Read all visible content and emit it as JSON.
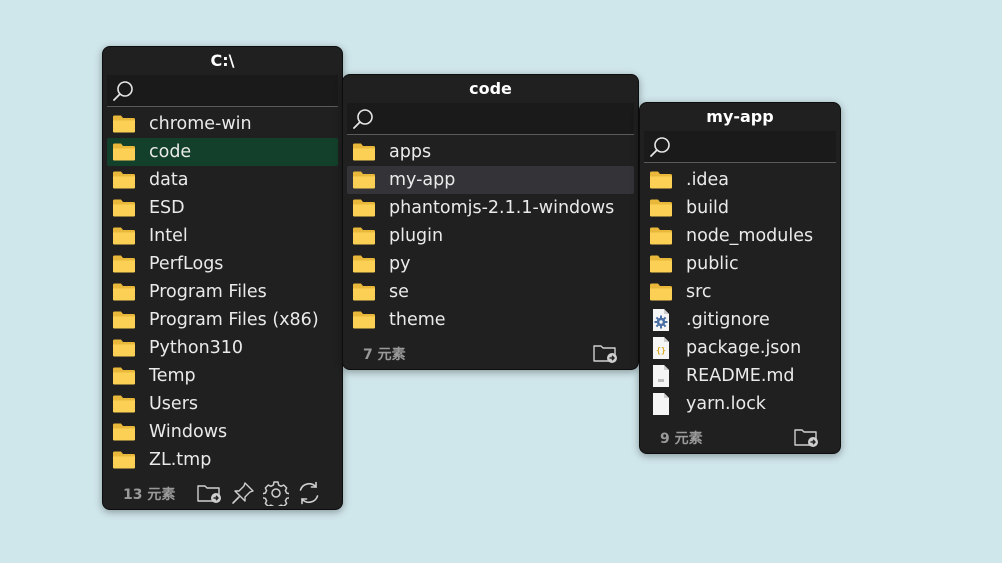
{
  "panels": [
    {
      "title": "C:\\",
      "search_placeholder": "",
      "items": [
        {
          "label": "chrome-win",
          "type": "folder"
        },
        {
          "label": "code",
          "type": "folder"
        },
        {
          "label": "data",
          "type": "folder"
        },
        {
          "label": "ESD",
          "type": "folder"
        },
        {
          "label": "Intel",
          "type": "folder"
        },
        {
          "label": "PerfLogs",
          "type": "folder"
        },
        {
          "label": "Program Files",
          "type": "folder"
        },
        {
          "label": "Program Files (x86)",
          "type": "folder"
        },
        {
          "label": "Python310",
          "type": "folder"
        },
        {
          "label": "Temp",
          "type": "folder"
        },
        {
          "label": "Users",
          "type": "folder"
        },
        {
          "label": "Windows",
          "type": "folder"
        },
        {
          "label": "ZL.tmp",
          "type": "folder"
        }
      ],
      "selected": "code",
      "count_label": "13 元素"
    },
    {
      "title": "code",
      "search_placeholder": "",
      "items": [
        {
          "label": "apps",
          "type": "folder"
        },
        {
          "label": "my-app",
          "type": "folder"
        },
        {
          "label": "phantomjs-2.1.1-windows",
          "type": "folder"
        },
        {
          "label": "plugin",
          "type": "folder"
        },
        {
          "label": "py",
          "type": "folder"
        },
        {
          "label": "se",
          "type": "folder"
        },
        {
          "label": "theme",
          "type": "folder"
        }
      ],
      "highlighted": "my-app",
      "count_label": "7 元素"
    },
    {
      "title": "my-app",
      "search_placeholder": "",
      "items": [
        {
          "label": ".idea",
          "type": "folder"
        },
        {
          "label": "build",
          "type": "folder"
        },
        {
          "label": "node_modules",
          "type": "folder"
        },
        {
          "label": "public",
          "type": "folder"
        },
        {
          "label": "src",
          "type": "folder"
        },
        {
          "label": ".gitignore",
          "type": "config-file"
        },
        {
          "label": "package.json",
          "type": "json-file"
        },
        {
          "label": "README.md",
          "type": "text-file"
        },
        {
          "label": "yarn.lock",
          "type": "blank-file"
        }
      ],
      "count_label": "9 元素"
    }
  ],
  "footer_icons": [
    "open-folder-icon",
    "pin-icon",
    "settings-gear-icon",
    "refresh-icon"
  ],
  "colors": {
    "background": "#cfe6eb",
    "panel": "#202020",
    "selected_row": "#13402a",
    "hover_row": "#343438",
    "folder": "#f4c542"
  }
}
